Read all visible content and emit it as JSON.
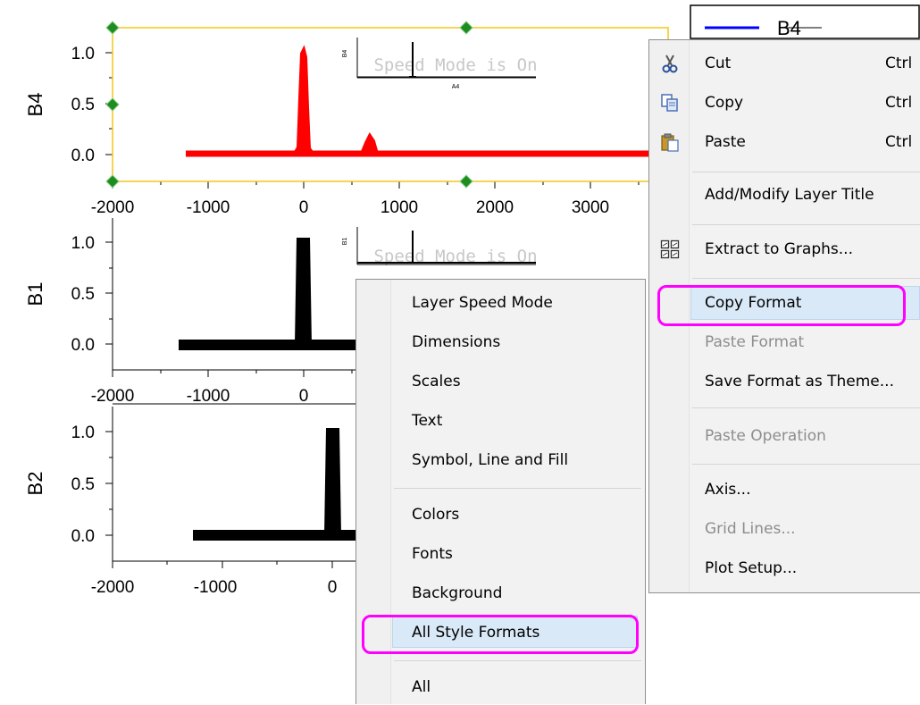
{
  "graph": {
    "layers": [
      {
        "ylabel": "B4",
        "yticks": [
          "1.0",
          "0.5",
          "0.0"
        ],
        "xticks": [
          "-2000",
          "-1000",
          "0",
          "1000",
          "2000",
          "3000"
        ],
        "watermark": "Speed Mode is On",
        "inset_ylabel": "B4",
        "inset_xlabel": "A4",
        "color": "#ff0000"
      },
      {
        "ylabel": "B1",
        "yticks": [
          "1.0",
          "0.5",
          "0.0"
        ],
        "xticks": [
          "-2000",
          "-1000",
          "0"
        ],
        "watermark": "Speed Mode is On",
        "inset_ylabel": "B1",
        "color": "#000000"
      },
      {
        "ylabel": "B2",
        "yticks": [
          "1.0",
          "0.5",
          "0.0"
        ],
        "xticks": [
          "-2000",
          "-1000",
          "0"
        ],
        "color": "#000000"
      }
    ],
    "legend_label": "B4",
    "legend_line_color": "#0000ff",
    "selection_color": "#f5c518",
    "handle_color": "#1e8c1e",
    "partial_ticks": [
      "000",
      "1000"
    ]
  },
  "left_menu": {
    "items": [
      {
        "label": "Layer Speed Mode"
      },
      {
        "label": "Dimensions"
      },
      {
        "label": "Scales"
      },
      {
        "label": "Text"
      },
      {
        "label": "Symbol, Line and Fill"
      },
      {
        "label": "Colors"
      },
      {
        "label": "Fonts"
      },
      {
        "label": "Background"
      },
      {
        "label": "All Style Formats"
      },
      {
        "label": "All"
      }
    ]
  },
  "right_menu": {
    "items": [
      {
        "label": "Cut",
        "shortcut": "Ctrl",
        "icon": "scissors-icon"
      },
      {
        "label": "Copy",
        "shortcut": "Ctrl",
        "icon": "copy-icon"
      },
      {
        "label": "Paste",
        "shortcut": "Ctrl",
        "icon": "paste-icon"
      },
      {
        "label": "Add/Modify Layer Title"
      },
      {
        "label": "Extract to Graphs...",
        "icon": "extract-graphs-icon"
      },
      {
        "label": "Copy Format"
      },
      {
        "label": "Paste Format",
        "disabled": true
      },
      {
        "label": "Save Format as Theme..."
      },
      {
        "label": "Paste Operation",
        "disabled": true
      },
      {
        "label": "Axis..."
      },
      {
        "label": "Grid Lines...",
        "disabled": true
      },
      {
        "label": "Plot Setup..."
      }
    ]
  },
  "highlight_color": "#ff00ff"
}
